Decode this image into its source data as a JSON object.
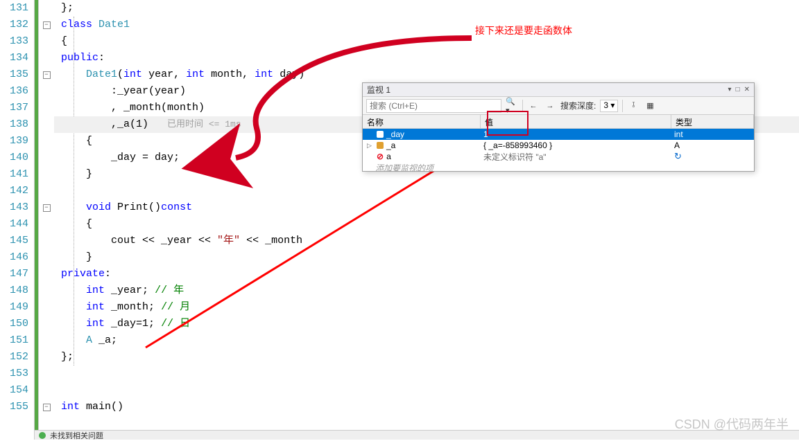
{
  "line_numbers": [
    "131",
    "132",
    "133",
    "134",
    "135",
    "136",
    "137",
    "138",
    "139",
    "140",
    "141",
    "142",
    "143",
    "144",
    "145",
    "146",
    "147",
    "148",
    "149",
    "150",
    "151",
    "152",
    "153",
    "154",
    "155"
  ],
  "code": {
    "l131": "};",
    "l132_kw": "class",
    "l132_cls": "Date1",
    "l133": "{",
    "l134_kw": "public",
    "l135_cls": "Date1",
    "l135_p1": "int",
    "l135_arg1": "year",
    "l135_p2": "int",
    "l135_arg2": "month",
    "l135_p3": "int",
    "l135_arg3": "day",
    "l136": ":_year(year)",
    "l137": ", _month(month)",
    "l138a": ",_a(1)",
    "l138_hint": "已用时间 <= 1ms",
    "l139": "{",
    "l140": "_day = day;",
    "l141": "}",
    "l143_kw": "void",
    "l143_fn": "Print()",
    "l143_cv": "const",
    "l144": "{",
    "l145a": "cout << _year << ",
    "l145_str": "\"年\"",
    "l145b": " << _month",
    "l146": "}",
    "l147_kw": "private",
    "l148_t": "int",
    "l148_v": "_year;",
    "l148_c": "// 年",
    "l149_t": "int",
    "l149_v": "_month;",
    "l149_c": "// 月",
    "l150_t": "int",
    "l150_v": "_day=1;",
    "l150_c": "// 日",
    "l151_t": "A",
    "l151_v": "_a;",
    "l152": "};",
    "l155_t": "int",
    "l155_fn": "main()"
  },
  "annotation_text": "接下来还是要走函数体",
  "watch": {
    "title": "监视 1",
    "search_placeholder": "搜索 (Ctrl+E)",
    "depth_label": "搜索深度:",
    "depth_value": "3",
    "col_name": "名称",
    "col_value": "值",
    "col_type": "类型",
    "rows": [
      {
        "name": "_day",
        "value": "1",
        "type": "int",
        "selected": true
      },
      {
        "name": "_a",
        "value": "{ _a=-858993460 }",
        "type": "A",
        "expandable": true
      },
      {
        "name": "a",
        "value": "未定义标识符 \"a\"",
        "type": "",
        "error": true
      }
    ],
    "add_hint": "添加要监视的项"
  },
  "watermark": "CSDN @代码两年半",
  "statusText": "未找到相关问题"
}
